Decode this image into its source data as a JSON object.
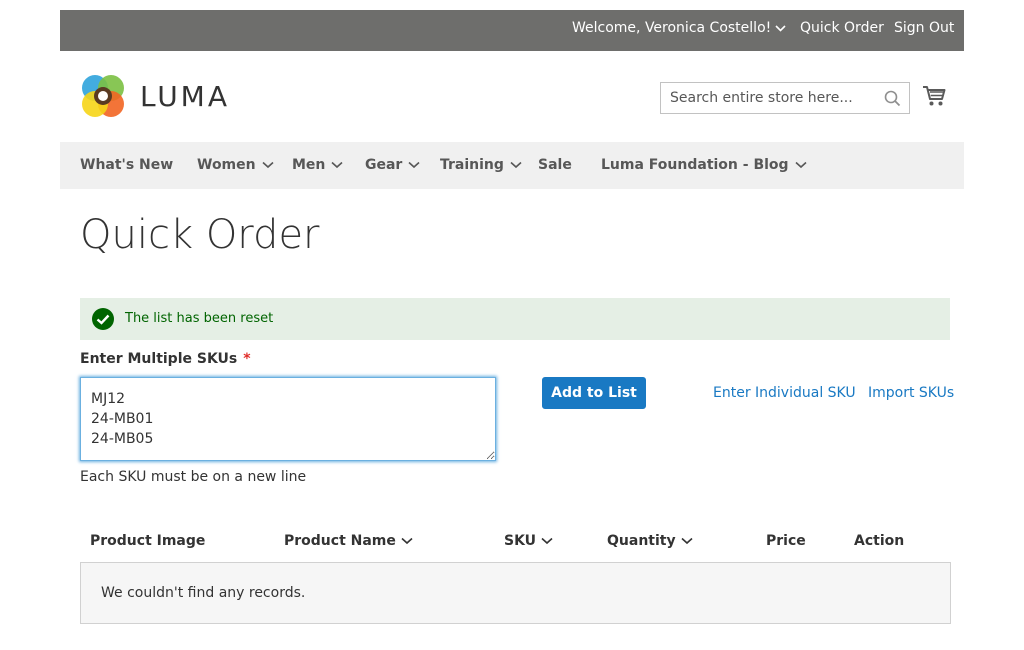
{
  "header": {
    "welcome": "Welcome, Veronica Costello!",
    "quick_order": "Quick Order",
    "sign_out": "Sign Out"
  },
  "logo": {
    "text": "LUMA"
  },
  "search": {
    "placeholder": "Search entire store here..."
  },
  "nav": {
    "items": [
      {
        "label": "What's New",
        "has_submenu": false
      },
      {
        "label": "Women",
        "has_submenu": true
      },
      {
        "label": "Men",
        "has_submenu": true
      },
      {
        "label": "Gear",
        "has_submenu": true
      },
      {
        "label": "Training",
        "has_submenu": true
      },
      {
        "label": "Sale",
        "has_submenu": false
      },
      {
        "label": "Luma Foundation - Blog",
        "has_submenu": true
      }
    ]
  },
  "page": {
    "title": "Quick Order"
  },
  "message": {
    "text": "The list has been reset",
    "type": "success"
  },
  "sku_form": {
    "label": "Enter Multiple SKUs",
    "required_mark": "*",
    "value": "MJ12\n24-MB01\n24-MB05",
    "note": "Each SKU must be on a new line",
    "add_button": "Add to List",
    "enter_individual": "Enter Individual SKU",
    "import_skus": "Import SKUs"
  },
  "table": {
    "columns": [
      {
        "label": "Product Image",
        "sortable": false
      },
      {
        "label": "Product Name",
        "sortable": true
      },
      {
        "label": "SKU",
        "sortable": true
      },
      {
        "label": "Quantity",
        "sortable": true
      },
      {
        "label": "Price",
        "sortable": false
      },
      {
        "label": "Action",
        "sortable": false
      }
    ],
    "empty_text": "We couldn't find any records."
  },
  "colors": {
    "topbar": "#6e6e6c",
    "nav": "#f0f0f0",
    "primary": "#1979c3",
    "success_bg": "#e5efe5",
    "success_text": "#006400"
  }
}
